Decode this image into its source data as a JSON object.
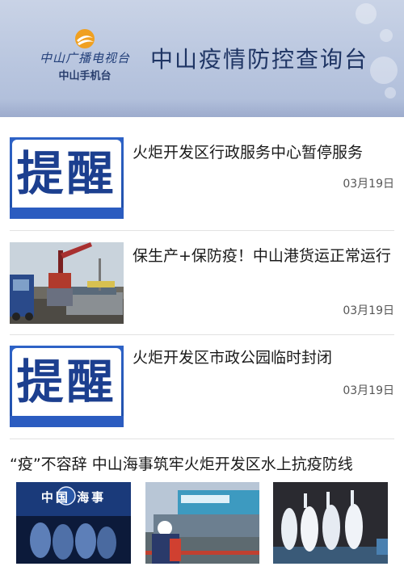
{
  "header": {
    "logo_text": "中山广播电视台",
    "logo_sub": "中山手机台",
    "title": "中山疫情防控查询台"
  },
  "news": [
    {
      "thumb_text": "提醒",
      "title": "火炬开发区行政服务中心暂停服务",
      "date": "03月19日"
    },
    {
      "thumb_image": "port-cargo-crane-photo",
      "title": "保生产+保防疫！中山港货运正常运行",
      "date": "03月19日"
    },
    {
      "thumb_text": "提醒",
      "title": "火炬开发区市政公园临时封闭",
      "date": "03月19日"
    }
  ],
  "gallery": {
    "title": "“疫”不容辞 中山海事筑牢火炬开发区水上抗疫防线",
    "images": [
      "maritime-bureau-signage-photo",
      "ship-inspection-photo",
      "protective-suits-team-photo"
    ],
    "signage_text": "中国 海事"
  },
  "colors": {
    "header_bg": "#b9c6df",
    "title_color": "#1f3564",
    "tixing_blue": "#1c3f8f",
    "date_gray": "#555555"
  }
}
